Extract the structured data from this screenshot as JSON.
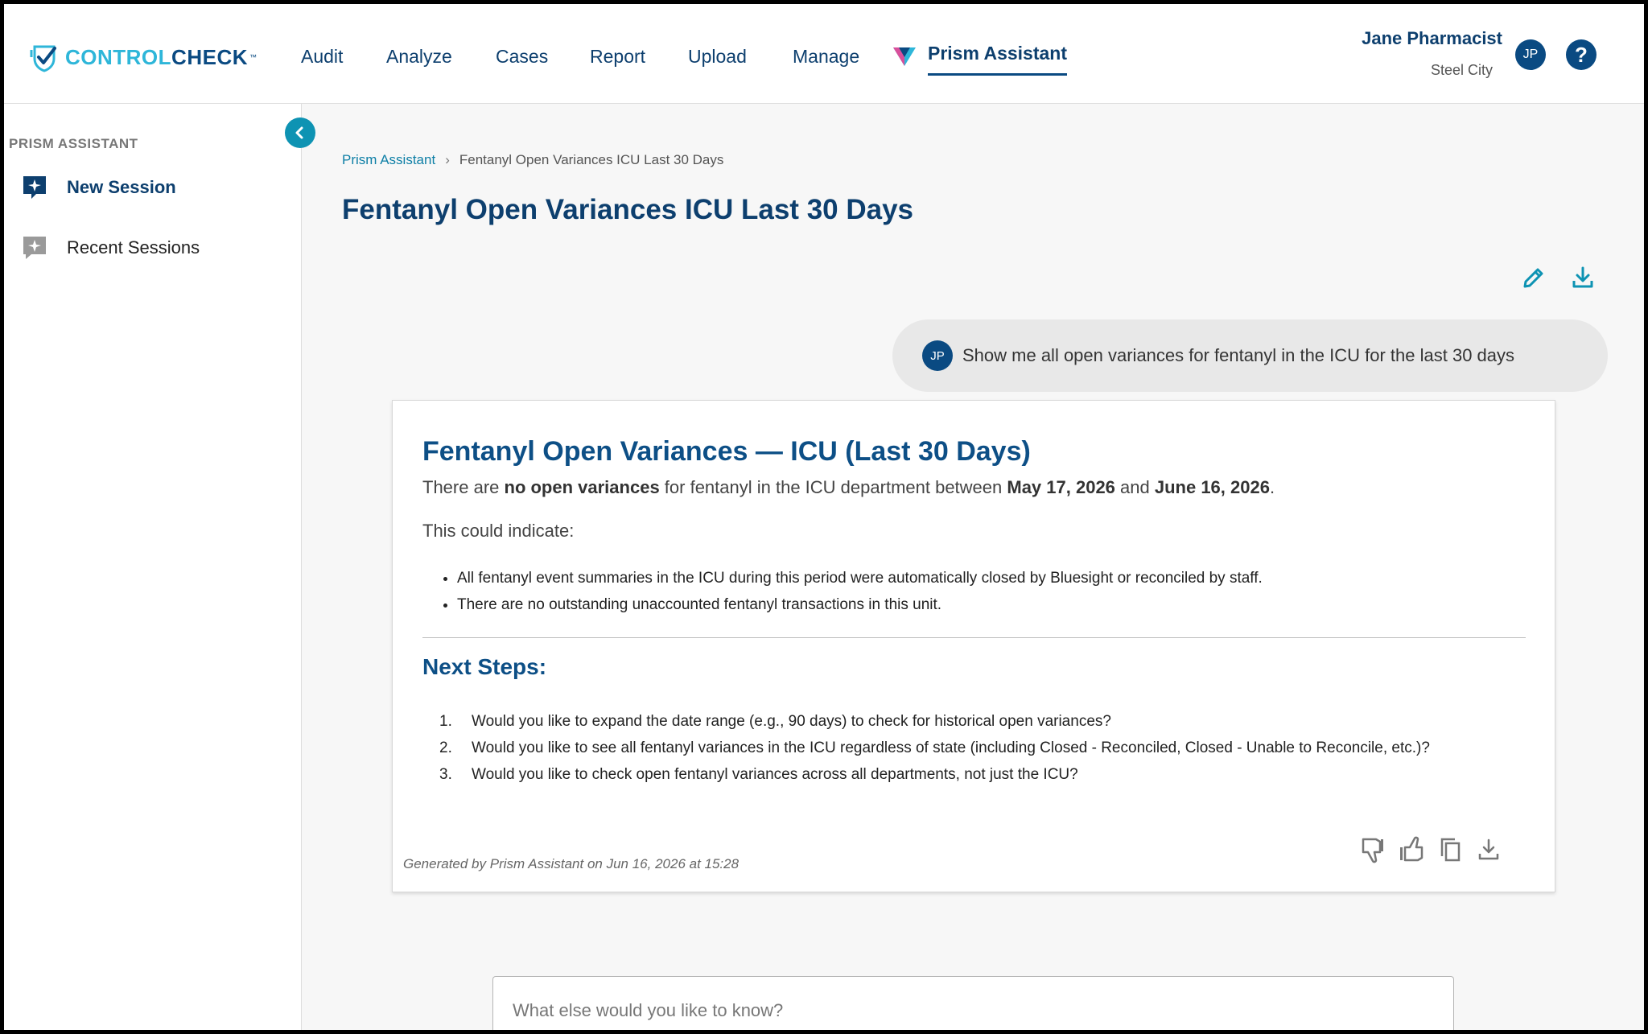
{
  "app": {
    "logo_control": "CONTROL",
    "logo_check": "CHECK",
    "logo_tm": "™"
  },
  "nav": {
    "items": [
      "Audit",
      "Analyze",
      "Cases",
      "Report",
      "Upload",
      "Manage"
    ],
    "prism": "Prism Assistant"
  },
  "user": {
    "name": "Jane Pharmacist",
    "org": "Steel City",
    "initials": "JP",
    "help": "?"
  },
  "sidebar": {
    "heading": "PRISM ASSISTANT",
    "new_session": "New Session",
    "recent_sessions": "Recent Sessions"
  },
  "breadcrumb": {
    "root": "Prism Assistant",
    "separator": "›",
    "current": "Fentanyl Open Variances ICU Last 30 Days"
  },
  "page": {
    "title": "Fentanyl Open Variances ICU Last 30 Days"
  },
  "conversation": {
    "user_initials": "JP",
    "user_message": "Show me all open variances for fentanyl in the ICU for the last 30 days"
  },
  "response": {
    "title": "Fentanyl Open Variances — ICU (Last 30 Days)",
    "summary": {
      "part1": "There are ",
      "bold1": "no open variances",
      "part2": " for fentanyl in the ICU department between ",
      "bold2": "May 17, 2026",
      "part3": " and ",
      "bold3": "June 16, 2026",
      "part4": "."
    },
    "indicate_label": "This could indicate:",
    "bullets": [
      "All fentanyl event summaries in the ICU during this period were automatically closed by Bluesight or reconciled by staff.",
      "There are no outstanding unaccounted fentanyl transactions in this unit."
    ],
    "next_steps_title": "Next Steps:",
    "next_steps": [
      {
        "num": "1.",
        "text": "Would you like to expand the date range (e.g., 90 days) to check for historical open variances?"
      },
      {
        "num": "2.",
        "text": "Would you like to see all fentanyl variances in the ICU regardless of state (including Closed - Reconciled, Closed - Unable to Reconcile, etc.)?"
      },
      {
        "num": "3.",
        "text": "Would you like to check open fentanyl variances across all departments, not just the ICU?"
      }
    ],
    "footer": "Generated by Prism Assistant on Jun 16, 2026 at 15:28"
  },
  "input": {
    "placeholder": "What else would you like to know?"
  },
  "colors": {
    "brand_navy": "#0a4a82",
    "brand_teal": "#2eb6d9",
    "accent_teal": "#0e93b3",
    "response_title": "#0d4f86"
  },
  "icons": {
    "edit": "pencil-icon",
    "download": "download-icon",
    "thumbs_down": "thumbs-down-icon",
    "thumbs_up": "thumbs-up-icon",
    "copy": "copy-icon",
    "collapse": "chevron-left-icon",
    "help": "help-icon"
  }
}
